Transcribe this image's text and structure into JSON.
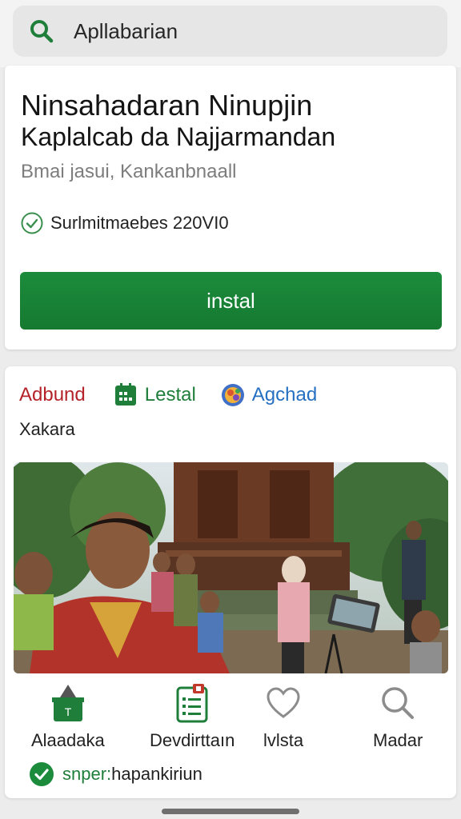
{
  "search": {
    "query": "Apllabarian",
    "icon": "search-icon"
  },
  "app": {
    "title_line1": "Ninsahadaran Ninupjin",
    "title_line2": "Kaplalcab da Najjarmandan",
    "developer": "Bmai jasui, Kankanbnaall",
    "verified_text": "Surlmitmaebes 220VI0",
    "install_label": "instal"
  },
  "tabs": [
    {
      "label": "Adbund",
      "color": "#b5232a"
    },
    {
      "label": "Lestal",
      "icon": "calendar-grid-icon",
      "color": "#1f7f3a"
    },
    {
      "label": "Agchad",
      "icon": "globe-avatar-icon",
      "color": "#2670c2"
    }
  ],
  "category": "Xakara",
  "actions": [
    {
      "label": "Alaadaka",
      "icon": "trophy-icon"
    },
    {
      "label": "Devdirttaın",
      "icon": "document-list-icon"
    },
    {
      "label": "lvlsta",
      "icon": "heart-icon"
    },
    {
      "label": "Madar",
      "icon": "magnifier-icon"
    }
  ],
  "status": {
    "prefix": "snper:",
    "rest": "hapankiriun"
  },
  "colors": {
    "accent_green": "#1c8b3c",
    "red": "#b5232a",
    "blue": "#2670c2"
  }
}
